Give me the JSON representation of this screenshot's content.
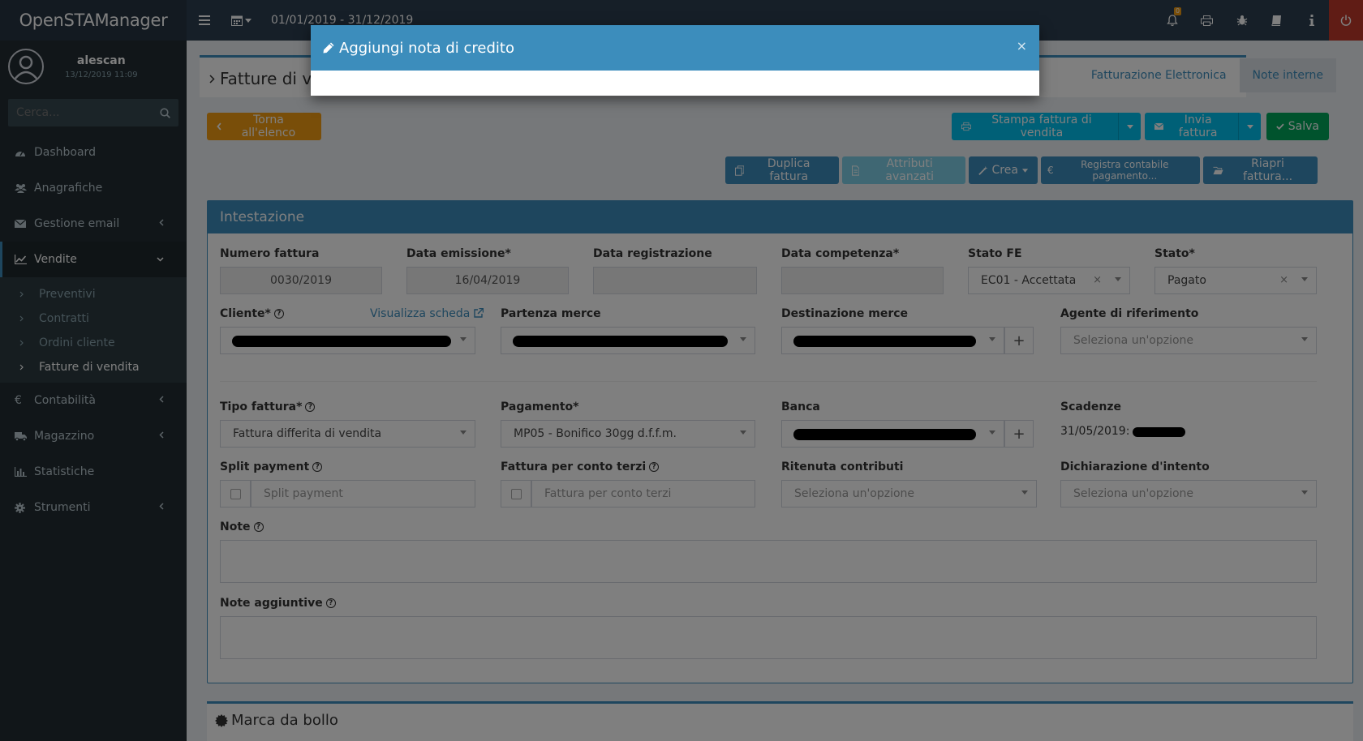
{
  "app": {
    "brand": "OpenSTAManager",
    "date_range": "01/01/2019 - 31/12/2019",
    "notif_count": "0"
  },
  "user": {
    "name": "alescan",
    "date": "13/12/2019 11:09"
  },
  "search": {
    "placeholder": "Cerca..."
  },
  "menu": {
    "dashboard": "Dashboard",
    "anagrafiche": "Anagrafiche",
    "email": "Gestione email",
    "vendite": "Vendite",
    "preventivi": "Preventivi",
    "contratti": "Contratti",
    "ordini": "Ordini cliente",
    "fatture": "Fatture di vendita",
    "contabilita": "Contabilità",
    "magazzino": "Magazzino",
    "statistiche": "Statistiche",
    "strumenti": "Strumenti"
  },
  "page": {
    "title": "Fatture di ve"
  },
  "tabs": {
    "fe": "Fatturazione Elettronica",
    "note": "Note interne"
  },
  "buttons": {
    "back": "Torna all'elenco",
    "print": "Stampa fattura di vendita",
    "send": "Invia fattura",
    "save": "Salva",
    "duplicate": "Duplica fattura",
    "advanced": "Attributi avanzati",
    "create": "Crea",
    "register": "Registra contabile pagamento...",
    "reopen": "Riapri fattura..."
  },
  "panel": {
    "heading": "Intestazione",
    "numero_label": "Numero fattura",
    "numero_value": "0030/2019",
    "emissione_label": "Data emissione*",
    "emissione_value": "16/04/2019",
    "registrazione_label": "Data registrazione",
    "competenza_label": "Data competenza*",
    "stato_fe_label": "Stato FE",
    "stato_fe_value": "EC01 - Accettata",
    "stato_label": "Stato*",
    "stato_value": "Pagato",
    "cliente_label": "Cliente*",
    "visualizza": "Visualizza scheda",
    "partenza_label": "Partenza merce",
    "destinazione_label": "Destinazione merce",
    "agente_label": "Agente di riferimento",
    "placeholder_select": "Seleziona un'opzione",
    "tipo_label": "Tipo fattura*",
    "tipo_value": "Fattura differita di vendita",
    "pagamento_label": "Pagamento*",
    "pagamento_value": "MP05 - Bonifico 30gg d.f.f.m.",
    "banca_label": "Banca",
    "scadenze_label": "Scadenze",
    "scadenze_value": "31/05/2019:",
    "split_label": "Split payment",
    "split_placeholder": "Split payment",
    "conto_terzi_label": "Fattura per conto terzi",
    "conto_terzi_placeholder": "Fattura per conto terzi",
    "ritenuta_label": "Ritenuta contributi",
    "dichiarazione_label": "Dichiarazione d'intento",
    "note_label": "Note",
    "note_agg_label": "Note aggiuntive"
  },
  "panel2": {
    "title": "Marca da bollo"
  },
  "modal": {
    "title": "Aggiungi nota di credito"
  }
}
